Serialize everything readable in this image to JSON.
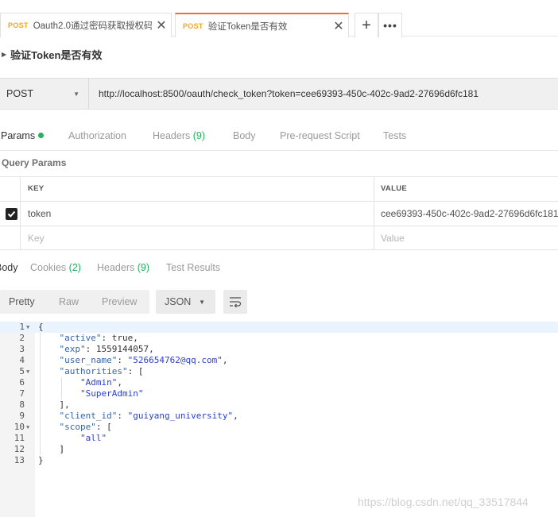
{
  "tabs": [
    {
      "method": "POST",
      "name": "Oauth2.0通过密码获取授权码",
      "close": "✕"
    },
    {
      "method": "POST",
      "name": "验证Token是否有效",
      "close": "✕"
    }
  ],
  "tab_actions": {
    "add": "+",
    "more": "•••"
  },
  "request": {
    "title": "验证Token是否有效",
    "method": "POST",
    "url": "http://localhost:8500/oauth/check_token?token=cee69393-450c-402c-9ad2-27696d6fc181"
  },
  "request_tabs": {
    "params": "Params",
    "authorization": "Authorization",
    "headers": "Headers",
    "headers_count": "(9)",
    "body": "Body",
    "prerequest": "Pre-request Script",
    "tests": "Tests"
  },
  "query_params": {
    "label": "Query Params",
    "col_key": "KEY",
    "col_value": "VALUE",
    "rows": [
      {
        "key": "token",
        "value": "cee69393-450c-402c-9ad2-27696d6fc181",
        "checked": true
      }
    ],
    "key_placeholder": "Key",
    "value_placeholder": "Value"
  },
  "response_tabs": {
    "body": "Body",
    "cookies": "Cookies",
    "cookies_count": "(2)",
    "headers": "Headers",
    "headers_count": "(9)",
    "test_results": "Test Results"
  },
  "response_toolbar": {
    "pretty": "Pretty",
    "raw": "Raw",
    "preview": "Preview",
    "format": "JSON"
  },
  "response_lines": [
    {
      "n": "1",
      "fold": true,
      "text": "{"
    },
    {
      "n": "2",
      "fold": false,
      "text": "    \"active\": true,"
    },
    {
      "n": "3",
      "fold": false,
      "text": "    \"exp\": 1559144057,"
    },
    {
      "n": "4",
      "fold": false,
      "text": "    \"user_name\": \"526654762@qq.com\","
    },
    {
      "n": "5",
      "fold": true,
      "text": "    \"authorities\": ["
    },
    {
      "n": "6",
      "fold": false,
      "text": "        \"Admin\","
    },
    {
      "n": "7",
      "fold": false,
      "text": "        \"SuperAdmin\""
    },
    {
      "n": "8",
      "fold": false,
      "text": "    ],"
    },
    {
      "n": "9",
      "fold": false,
      "text": "    \"client_id\": \"guiyang_university\","
    },
    {
      "n": "10",
      "fold": true,
      "text": "    \"scope\": ["
    },
    {
      "n": "11",
      "fold": false,
      "text": "        \"all\""
    },
    {
      "n": "12",
      "fold": false,
      "text": "    ]"
    },
    {
      "n": "13",
      "fold": false,
      "text": "}"
    }
  ],
  "watermark": "https://blog.csdn.net/qq_33517844",
  "colors": {
    "accent": "#f26b3a",
    "method_post": "#f5a623",
    "success": "#27ae60",
    "json_string": "#2a3fcf",
    "json_key": "#3366aa"
  }
}
